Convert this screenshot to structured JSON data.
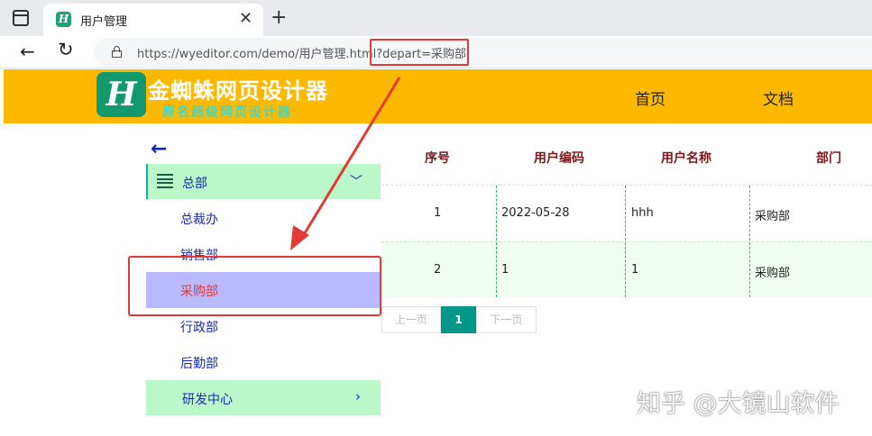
{
  "browser": {
    "tab_title": "用户管理",
    "tab_favicon_letter": "H",
    "close_glyph": "✕",
    "new_tab_glyph": "+",
    "back_glyph": "←",
    "reload_glyph": "↻",
    "url": "https://wyeditor.com/demo/用户管理.html?depart=采购部"
  },
  "site": {
    "logo_letter": "H",
    "logo_name": "金蜘蛛网页设计器",
    "logo_subtitle": "原名超级网页设计器",
    "nav": [
      "首页",
      "文档"
    ]
  },
  "sidebar": {
    "back_glyph": "←",
    "group": {
      "label": "总部",
      "chevron": "﹀"
    },
    "items": [
      "总裁办",
      "销售部",
      "采购部",
      "行政部",
      "后勤部"
    ],
    "active_item": "采购部",
    "group2": {
      "label": "研发中心",
      "chevron": "›"
    }
  },
  "table": {
    "headers": [
      "序号",
      "用户编码",
      "用户名称",
      "部门"
    ],
    "rows": [
      [
        "1",
        "2022-05-28",
        "hhh",
        "采购部"
      ],
      [
        "2",
        "1",
        "1",
        "采购部"
      ]
    ]
  },
  "pager": {
    "prev": "上一页",
    "current": "1",
    "next": "下一页"
  },
  "watermark": "知乎 @大镜山软件",
  "colors": {
    "header_bg": "#fcb900",
    "menu_bg": "#bbf7c9",
    "active_bg": "#b9b9ff",
    "annotation_red": "#e53935",
    "pager_active": "#009688"
  }
}
